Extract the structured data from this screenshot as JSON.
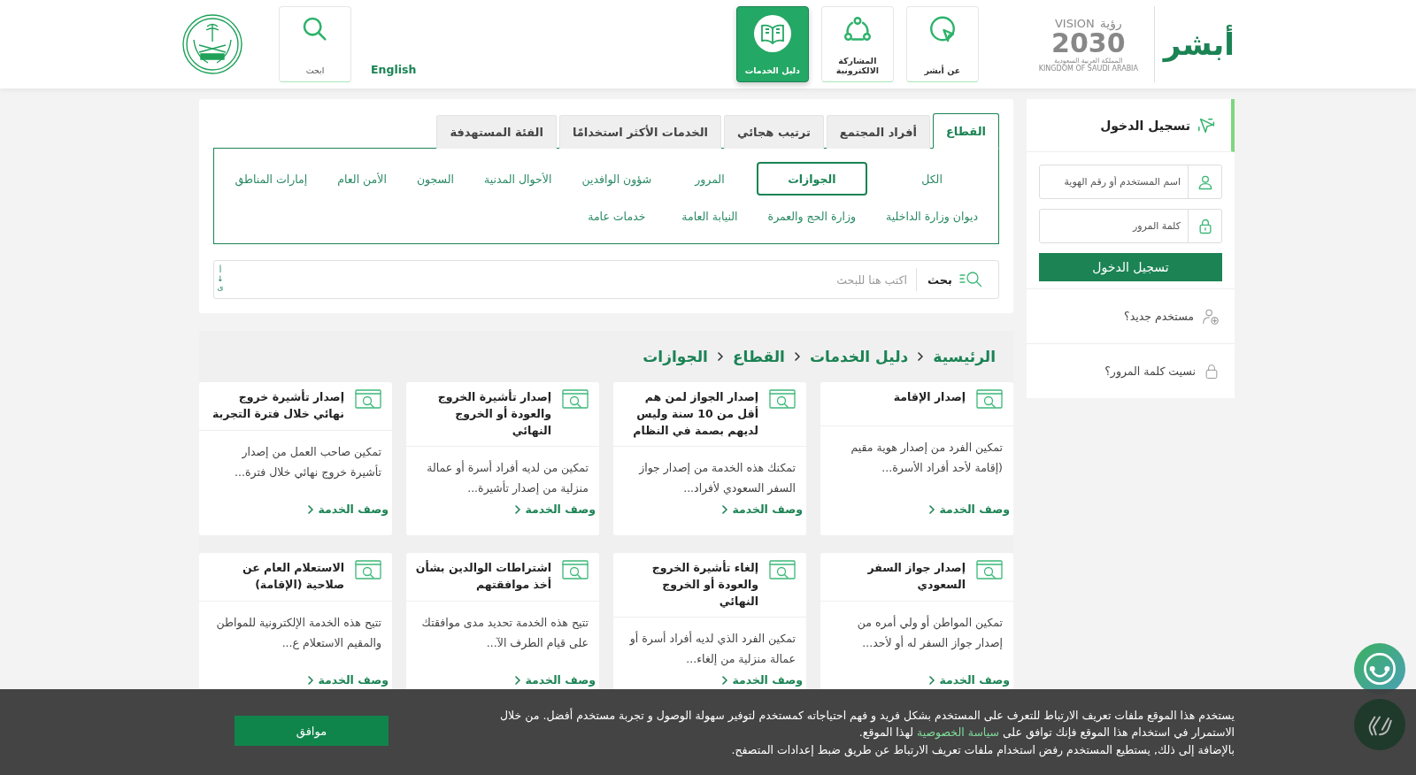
{
  "header": {
    "absher_logo": "أبشر",
    "vision_logo": {
      "vision": "VISION",
      "ruya": "رؤية",
      "year": "2030",
      "country_ar": "المملكة العربية السعودية",
      "country_en": "KINGDOM OF SAUDI ARABIA"
    },
    "nav": [
      {
        "label": "عن أبشر",
        "kind": "pointer",
        "selected": false
      },
      {
        "label": "المشاركة الالكترونية",
        "kind": "network",
        "selected": false
      },
      {
        "label": "دليل الخدمات",
        "kind": "book",
        "selected": true
      }
    ],
    "language": "English",
    "search_button": "ابحث"
  },
  "login": {
    "title": "تسجيل الدخول",
    "username_placeholder": "اسم المستخدم أو رقم الهوية",
    "password_placeholder": "كلمة المرور",
    "submit": "تسجيل الدخول",
    "new_user": "مستخدم جديد؟",
    "forgot_password": "نسيت كلمة المرور؟"
  },
  "tabs": [
    {
      "label": "القطاع",
      "selected": true
    },
    {
      "label": "أفراد المجتمع",
      "selected": false
    },
    {
      "label": "ترتيب هجائي",
      "selected": false
    },
    {
      "label": "الخدمات الأكثر استخدامًا",
      "selected": false
    },
    {
      "label": "الفئة المستهدفة",
      "selected": false
    }
  ],
  "filters": [
    {
      "label": "الكل",
      "selected": false
    },
    {
      "label": "الجوازات",
      "selected": true
    },
    {
      "label": "المرور",
      "selected": false
    },
    {
      "label": "شؤون الوافدين",
      "selected": false
    },
    {
      "label": "الأحوال المدنية",
      "selected": false
    },
    {
      "label": "السجون",
      "selected": false
    },
    {
      "label": "الأمن العام",
      "selected": false
    },
    {
      "label": "إمارات المناطق",
      "selected": false
    },
    {
      "label": "ديوان وزارة الداخلية",
      "selected": false
    },
    {
      "label": "وزارة الحج والعمرة",
      "selected": false
    },
    {
      "label": "النيابة العامة",
      "selected": false
    },
    {
      "label": "خدمات عامة",
      "selected": false
    }
  ],
  "search": {
    "button": "بحث",
    "placeholder": "اكتب هنا للبحث",
    "sort": [
      "أ",
      "↓",
      "ى"
    ]
  },
  "breadcrumb": [
    "الرئيسية",
    "دليل الخدمات",
    "القطاع",
    "الجوازات"
  ],
  "cards": [
    {
      "title": "إصدار الإقامة",
      "description": "تمكين الفرد من إصدار هوية مقيم (إقامة لأحد أفراد الأسرة...",
      "link": "وصف الخدمة"
    },
    {
      "title": "إصدار الجواز لمن هم أقل من 10 سنة وليس لديهم بصمة في النظام",
      "description": "تمكنك هذه الخدمة من إصدار جواز السفر السعودي لأفراد...",
      "link": "وصف الخدمة"
    },
    {
      "title": "إصدار تأشيرة الخروج والعودة أو الخروج النهائي",
      "description": "تمكين من لديه أفراد أسرة أو عمالة منزلية من إصدار تأشيرة...",
      "link": "وصف الخدمة"
    },
    {
      "title": "إصدار تأشيرة خروج نهائي خلال فترة التجربة",
      "description": "تمكين صاحب العمل من إصدار تأشيرة خروج نهائي خلال فترة...",
      "link": "وصف الخدمة"
    },
    {
      "title": "إصدار جواز السفر السعودي",
      "description": "تمكين المواطن أو ولي أمره من إصدار جواز السفر له أو لأحد...",
      "link": "وصف الخدمة"
    },
    {
      "title": "إلغاء تأشيرة الخروج والعودة أو الخروج النهائي",
      "description": "تمكين الفرد الذي لديه أفراد أسرة أو عمالة منزلية من إلغاء...",
      "link": "وصف الخدمة"
    },
    {
      "title": "اشتراطات الوالدين بشأن أخذ موافقتهم",
      "description": "تتيح هذه الخدمة تحديد مدى موافقتك على قيام الطرف الآ...",
      "link": "وصف الخدمة"
    },
    {
      "title": "الاستعلام العام عن صلاحية (الإقامة)",
      "description": "تتيح هذه الخدمة الإلكترونية للمواطن والمقيم الاستعلام ع...",
      "link": "وصف الخدمة"
    }
  ],
  "cookie_notice": {
    "text_before": "يستخدم هذا الموقع ملفات تعريف الارتباط للتعرف على المستخدم بشكل فريد و فهم احتياجاته كمستخدم لتوفير سهولة الوصول و تجربة مستخدم أفضل. من خلال الاستمرار في استخدام هذا الموقع فإنك توافق على",
    "link": "سياسة الخصوصية",
    "text_after": "لهذا الموقع.",
    "text_last": "بالإضافة إلى ذلك, يستطيع المستخدم رفض استخدام ملفات تعريف الارتباط عن طريق ضبط إعدادات المتصفح.",
    "accept": "موافق"
  }
}
